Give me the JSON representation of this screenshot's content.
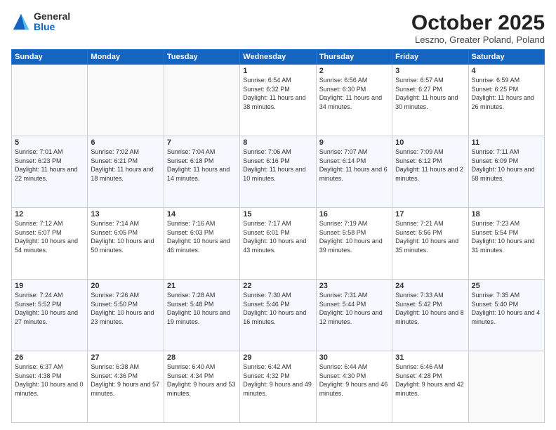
{
  "logo": {
    "general": "General",
    "blue": "Blue"
  },
  "header": {
    "month": "October 2025",
    "location": "Leszno, Greater Poland, Poland"
  },
  "weekdays": [
    "Sunday",
    "Monday",
    "Tuesday",
    "Wednesday",
    "Thursday",
    "Friday",
    "Saturday"
  ],
  "weeks": [
    [
      {
        "day": "",
        "sunrise": "",
        "sunset": "",
        "daylight": ""
      },
      {
        "day": "",
        "sunrise": "",
        "sunset": "",
        "daylight": ""
      },
      {
        "day": "",
        "sunrise": "",
        "sunset": "",
        "daylight": ""
      },
      {
        "day": "1",
        "sunrise": "Sunrise: 6:54 AM",
        "sunset": "Sunset: 6:32 PM",
        "daylight": "Daylight: 11 hours and 38 minutes."
      },
      {
        "day": "2",
        "sunrise": "Sunrise: 6:56 AM",
        "sunset": "Sunset: 6:30 PM",
        "daylight": "Daylight: 11 hours and 34 minutes."
      },
      {
        "day": "3",
        "sunrise": "Sunrise: 6:57 AM",
        "sunset": "Sunset: 6:27 PM",
        "daylight": "Daylight: 11 hours and 30 minutes."
      },
      {
        "day": "4",
        "sunrise": "Sunrise: 6:59 AM",
        "sunset": "Sunset: 6:25 PM",
        "daylight": "Daylight: 11 hours and 26 minutes."
      }
    ],
    [
      {
        "day": "5",
        "sunrise": "Sunrise: 7:01 AM",
        "sunset": "Sunset: 6:23 PM",
        "daylight": "Daylight: 11 hours and 22 minutes."
      },
      {
        "day": "6",
        "sunrise": "Sunrise: 7:02 AM",
        "sunset": "Sunset: 6:21 PM",
        "daylight": "Daylight: 11 hours and 18 minutes."
      },
      {
        "day": "7",
        "sunrise": "Sunrise: 7:04 AM",
        "sunset": "Sunset: 6:18 PM",
        "daylight": "Daylight: 11 hours and 14 minutes."
      },
      {
        "day": "8",
        "sunrise": "Sunrise: 7:06 AM",
        "sunset": "Sunset: 6:16 PM",
        "daylight": "Daylight: 11 hours and 10 minutes."
      },
      {
        "day": "9",
        "sunrise": "Sunrise: 7:07 AM",
        "sunset": "Sunset: 6:14 PM",
        "daylight": "Daylight: 11 hours and 6 minutes."
      },
      {
        "day": "10",
        "sunrise": "Sunrise: 7:09 AM",
        "sunset": "Sunset: 6:12 PM",
        "daylight": "Daylight: 11 hours and 2 minutes."
      },
      {
        "day": "11",
        "sunrise": "Sunrise: 7:11 AM",
        "sunset": "Sunset: 6:09 PM",
        "daylight": "Daylight: 10 hours and 58 minutes."
      }
    ],
    [
      {
        "day": "12",
        "sunrise": "Sunrise: 7:12 AM",
        "sunset": "Sunset: 6:07 PM",
        "daylight": "Daylight: 10 hours and 54 minutes."
      },
      {
        "day": "13",
        "sunrise": "Sunrise: 7:14 AM",
        "sunset": "Sunset: 6:05 PM",
        "daylight": "Daylight: 10 hours and 50 minutes."
      },
      {
        "day": "14",
        "sunrise": "Sunrise: 7:16 AM",
        "sunset": "Sunset: 6:03 PM",
        "daylight": "Daylight: 10 hours and 46 minutes."
      },
      {
        "day": "15",
        "sunrise": "Sunrise: 7:17 AM",
        "sunset": "Sunset: 6:01 PM",
        "daylight": "Daylight: 10 hours and 43 minutes."
      },
      {
        "day": "16",
        "sunrise": "Sunrise: 7:19 AM",
        "sunset": "Sunset: 5:58 PM",
        "daylight": "Daylight: 10 hours and 39 minutes."
      },
      {
        "day": "17",
        "sunrise": "Sunrise: 7:21 AM",
        "sunset": "Sunset: 5:56 PM",
        "daylight": "Daylight: 10 hours and 35 minutes."
      },
      {
        "day": "18",
        "sunrise": "Sunrise: 7:23 AM",
        "sunset": "Sunset: 5:54 PM",
        "daylight": "Daylight: 10 hours and 31 minutes."
      }
    ],
    [
      {
        "day": "19",
        "sunrise": "Sunrise: 7:24 AM",
        "sunset": "Sunset: 5:52 PM",
        "daylight": "Daylight: 10 hours and 27 minutes."
      },
      {
        "day": "20",
        "sunrise": "Sunrise: 7:26 AM",
        "sunset": "Sunset: 5:50 PM",
        "daylight": "Daylight: 10 hours and 23 minutes."
      },
      {
        "day": "21",
        "sunrise": "Sunrise: 7:28 AM",
        "sunset": "Sunset: 5:48 PM",
        "daylight": "Daylight: 10 hours and 19 minutes."
      },
      {
        "day": "22",
        "sunrise": "Sunrise: 7:30 AM",
        "sunset": "Sunset: 5:46 PM",
        "daylight": "Daylight: 10 hours and 16 minutes."
      },
      {
        "day": "23",
        "sunrise": "Sunrise: 7:31 AM",
        "sunset": "Sunset: 5:44 PM",
        "daylight": "Daylight: 10 hours and 12 minutes."
      },
      {
        "day": "24",
        "sunrise": "Sunrise: 7:33 AM",
        "sunset": "Sunset: 5:42 PM",
        "daylight": "Daylight: 10 hours and 8 minutes."
      },
      {
        "day": "25",
        "sunrise": "Sunrise: 7:35 AM",
        "sunset": "Sunset: 5:40 PM",
        "daylight": "Daylight: 10 hours and 4 minutes."
      }
    ],
    [
      {
        "day": "26",
        "sunrise": "Sunrise: 6:37 AM",
        "sunset": "Sunset: 4:38 PM",
        "daylight": "Daylight: 10 hours and 0 minutes."
      },
      {
        "day": "27",
        "sunrise": "Sunrise: 6:38 AM",
        "sunset": "Sunset: 4:36 PM",
        "daylight": "Daylight: 9 hours and 57 minutes."
      },
      {
        "day": "28",
        "sunrise": "Sunrise: 6:40 AM",
        "sunset": "Sunset: 4:34 PM",
        "daylight": "Daylight: 9 hours and 53 minutes."
      },
      {
        "day": "29",
        "sunrise": "Sunrise: 6:42 AM",
        "sunset": "Sunset: 4:32 PM",
        "daylight": "Daylight: 9 hours and 49 minutes."
      },
      {
        "day": "30",
        "sunrise": "Sunrise: 6:44 AM",
        "sunset": "Sunset: 4:30 PM",
        "daylight": "Daylight: 9 hours and 46 minutes."
      },
      {
        "day": "31",
        "sunrise": "Sunrise: 6:46 AM",
        "sunset": "Sunset: 4:28 PM",
        "daylight": "Daylight: 9 hours and 42 minutes."
      },
      {
        "day": "",
        "sunrise": "",
        "sunset": "",
        "daylight": ""
      }
    ]
  ]
}
